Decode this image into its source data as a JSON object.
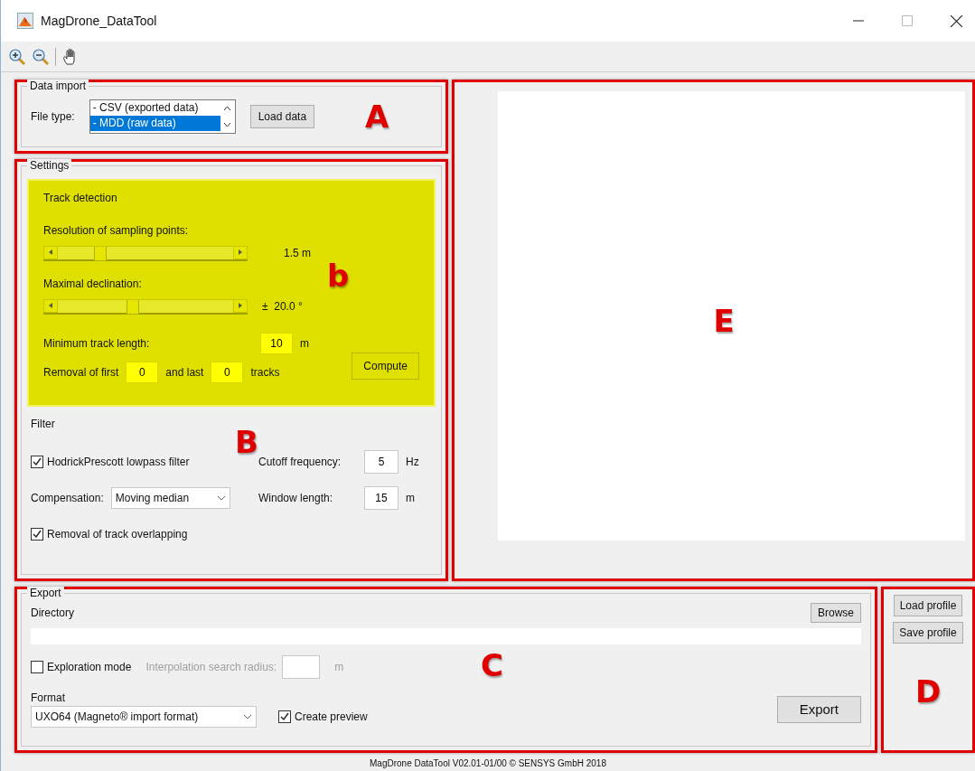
{
  "window": {
    "title": "MagDrone_DataTool"
  },
  "data_import": {
    "annotation": "A",
    "title": "Data import",
    "file_type_label": "File type:",
    "file_types": [
      {
        "text": "- CSV (exported data)",
        "selected": false
      },
      {
        "text": "- MDD (raw data)",
        "selected": true
      }
    ],
    "load_button": "Load data"
  },
  "settings": {
    "annotation": "B",
    "title": "Settings",
    "track_detection": {
      "annotation": "b",
      "title": "Track detection",
      "sliders": [
        {
          "label": "Resolution of sampling points:",
          "level": 0.22,
          "reading": "1.5 m"
        },
        {
          "label": "Maximal declination:",
          "level": 0.42,
          "reading": "±  20.0 °"
        }
      ],
      "min_length": {
        "label": "Minimum track length:",
        "value": "10",
        "unit": "m"
      },
      "removal": {
        "first_label": "Removal of first",
        "first": "0",
        "last_label": "and last",
        "last": "0",
        "unit": "tracks"
      },
      "compute_button": "Compute"
    },
    "filter": {
      "title": "Filter",
      "hp_filter": {
        "label": "HodrickPrescott lowpass filter",
        "checked": true
      },
      "cutoff": {
        "label": "Cutoff frequency:",
        "value": "5",
        "unit": "Hz"
      },
      "compensation": {
        "label": "Compensation:",
        "value": "Moving median"
      },
      "window_length": {
        "label": "Window length:",
        "value": "15",
        "unit": "m"
      },
      "overlap": {
        "label": "Removal of track overlapping",
        "checked": true
      }
    }
  },
  "plot": {
    "annotation": "E"
  },
  "export": {
    "annotation": "C",
    "title": "Export",
    "directory_label": "Directory",
    "browse_button": "Browse",
    "exploration": {
      "label": "Exploration mode",
      "checked": false
    },
    "radius": {
      "label": "Interpolation search radius:",
      "unit": "m",
      "disabled": true
    },
    "format_label": "Format",
    "format": "UXO64 (Magneto® import format)",
    "preview": {
      "label": "Create preview",
      "checked": true
    },
    "export_button": "Export"
  },
  "profile": {
    "annotation": "D",
    "buttons": [
      "Load profile",
      "Save profile"
    ]
  },
  "footer": "MagDrone DataTool V02.01-01/00 © SENSYS GmbH 2018"
}
